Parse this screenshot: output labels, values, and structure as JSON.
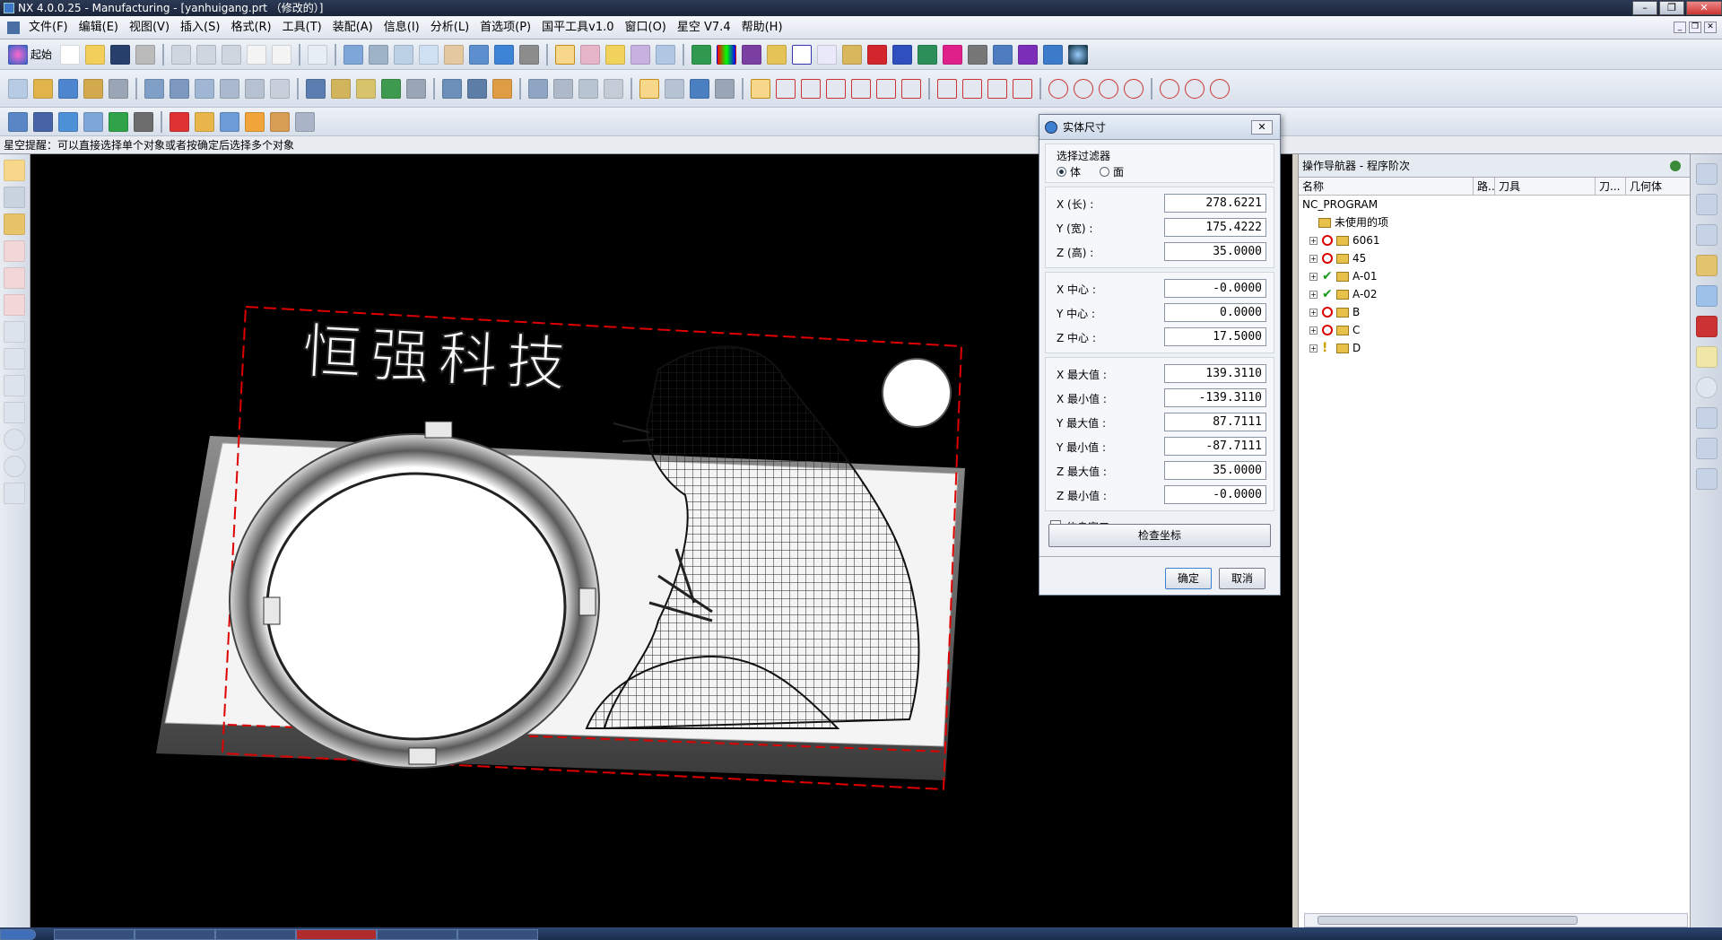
{
  "window": {
    "title": "NX 4.0.0.25 - Manufacturing - [yanhuigang.prt （修改的）]"
  },
  "menu": [
    "文件(F)",
    "编辑(E)",
    "视图(V)",
    "插入(S)",
    "格式(R)",
    "工具(T)",
    "装配(A)",
    "信息(I)",
    "分析(L)",
    "首选项(P)",
    "国平工具v1.0",
    "窗口(O)",
    "星空 V7.4",
    "帮助(H)"
  ],
  "toolbar": {
    "start_label": "起始"
  },
  "hint": "星空提醒：可以直接选择单个对象或者按确定后选择多个对象",
  "viewport": {
    "model_text": "恒强科技"
  },
  "dialog": {
    "title": "实体尺寸",
    "filter_label": "选择过滤器",
    "filter_options": [
      "体",
      "面"
    ],
    "filter_selected": "体",
    "size": [
      {
        "label": "X (长) :",
        "value": "278.6221"
      },
      {
        "label": "Y (宽) :",
        "value": "175.4222"
      },
      {
        "label": "Z (高) :",
        "value": "35.0000"
      }
    ],
    "center": [
      {
        "label": "X 中心 :",
        "value": "-0.0000"
      },
      {
        "label": "Y 中心 :",
        "value": "0.0000"
      },
      {
        "label": "Z 中心 :",
        "value": "17.5000"
      }
    ],
    "extents": [
      {
        "label": "X 最大值 :",
        "value": "139.3110"
      },
      {
        "label": "X 最小值 :",
        "value": "-139.3110"
      },
      {
        "label": "Y 最大值 :",
        "value": "87.7111"
      },
      {
        "label": "Y 最小值 :",
        "value": "-87.7111"
      },
      {
        "label": "Z 最大值 :",
        "value": "35.0000"
      },
      {
        "label": "Z 最小值 :",
        "value": "-0.0000"
      }
    ],
    "info_window_label": "信息窗口",
    "check_coords_label": "检查坐标",
    "ok_label": "确定",
    "cancel_label": "取消"
  },
  "navigator": {
    "title": "操作导航器 - 程序阶次",
    "columns": [
      "名称",
      "路...",
      "刀具",
      "刀...",
      "几何体"
    ],
    "root": "NC_PROGRAM",
    "unused": "未使用的项",
    "programs": [
      {
        "name": "6061",
        "status": "no"
      },
      {
        "name": "45",
        "status": "no"
      },
      {
        "name": "A-01",
        "status": "ok"
      },
      {
        "name": "A-02",
        "status": "ok"
      },
      {
        "name": "B",
        "status": "no"
      },
      {
        "name": "C",
        "status": "no"
      },
      {
        "name": "D",
        "status": "warn"
      }
    ]
  },
  "colors": {
    "accent": "#3d7fd1",
    "boundary": "#e00000",
    "viewport_bg": "#000000"
  }
}
